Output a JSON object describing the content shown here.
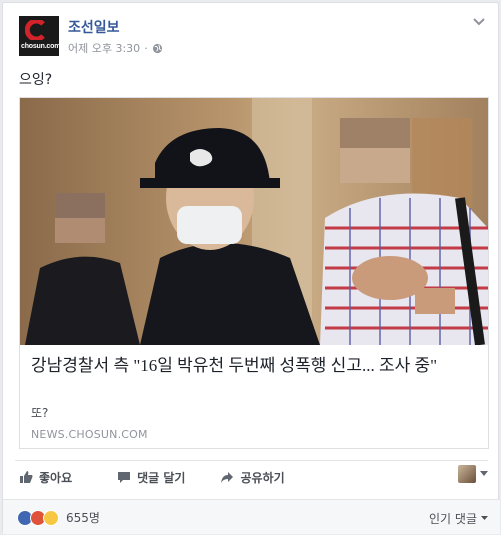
{
  "post": {
    "page_name": "조선일보",
    "timestamp": "어제 오후 3:30",
    "text": "으잉?",
    "avatar_brand": "chosun.com"
  },
  "link": {
    "headline": "강남경찰서 측 \"16일 박유천 두번째 성폭행 신고... 조사 중\"",
    "description": "또?",
    "domain": "NEWS.CHOSUN.COM"
  },
  "actions": {
    "like": "좋아요",
    "comment": "댓글 달기",
    "share": "공유하기"
  },
  "reactions": {
    "count": "655명",
    "sort_label": "인기 댓글"
  },
  "colors": {
    "link_blue": "#365899",
    "like_blue": "#4267b2",
    "angry": "#e0533b",
    "haha": "#f7c744"
  }
}
